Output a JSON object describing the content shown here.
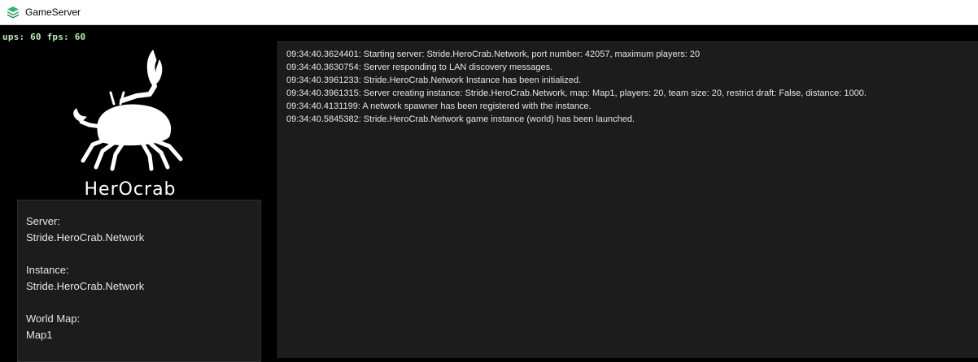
{
  "window": {
    "title": "GameServer",
    "icon": "layers-icon"
  },
  "stats": {
    "text": "ups: 60 fps: 60"
  },
  "logo": {
    "wordmark": "HerOcrab"
  },
  "info": {
    "server_label": "Server:",
    "server_value": "Stride.HeroCrab.Network",
    "instance_label": "Instance:",
    "instance_value": "Stride.HeroCrab.Network",
    "map_label": "World Map:",
    "map_value": "Map1"
  },
  "log": {
    "lines": [
      "09:34:40.3624401: Starting server: Stride.HeroCrab.Network, port number: 42057, maximum players: 20",
      "09:34:40.3630754: Server responding to LAN discovery messages.",
      "09:34:40.3961233: Stride.HeroCrab.Network Instance has been initialized.",
      "09:34:40.3961315: Server creating instance: Stride.HeroCrab.Network, map: Map1, players: 20, team size: 20, restrict draft: False, distance: 1000.",
      "09:34:40.4131199: A network spawner has been registered with the instance.",
      "09:34:40.5845382: Stride.HeroCrab.Network game instance (world) has been launched."
    ]
  },
  "colors": {
    "stats_text": "#b8f0b0",
    "panel_bg": "#1c1c1c",
    "icon_green": "#2eb872"
  }
}
